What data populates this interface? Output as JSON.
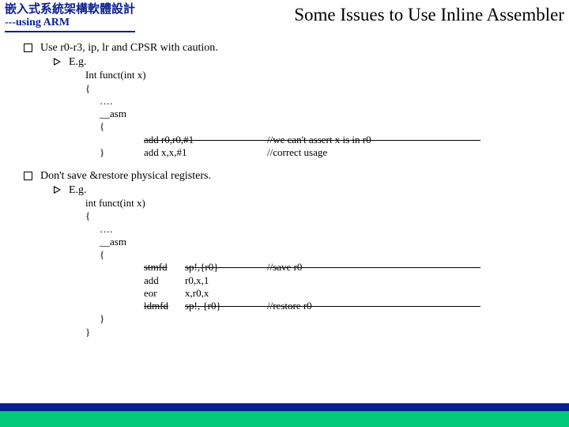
{
  "header": {
    "cn": "嵌入式系統架構軟體設計",
    "en": "---using ARM",
    "title": "Some Issues to Use Inline Assembler"
  },
  "item1": {
    "text": "Use r0-r3, ip, lr and CPSR with caution.",
    "eg": "E.g.",
    "code": {
      "l1": "Int funct(int x)",
      "l2": "{",
      "l3": "….",
      "l4": "__asm",
      "l5": "{",
      "bad_instr": "add r0,r0,#1",
      "bad_cmt": "//we can't assert x is in r0",
      "good_instr": "add x,x,#1",
      "good_cmt": "//correct usage",
      "l8": "}"
    }
  },
  "item2": {
    "text": "Don't save &restore physical registers.",
    "eg": "E.g.",
    "code": {
      "l1": "int funct(int x)",
      "l2": "{",
      "l3": "….",
      "l4": "__asm",
      "l5": "{",
      "r1_instr": "stmfd",
      "r1_args": "sp!,{r0}",
      "r1_cmt": "//save r0",
      "r2_instr": "add",
      "r2_args": "r0,x,1",
      "r3_instr": "eor",
      "r3_args": "x,r0,x",
      "r4_instr": "ldmfd",
      "r4_args": "sp!, {r0}",
      "r4_cmt": "//restore r0",
      "l6": "}",
      "l7": "}"
    }
  }
}
